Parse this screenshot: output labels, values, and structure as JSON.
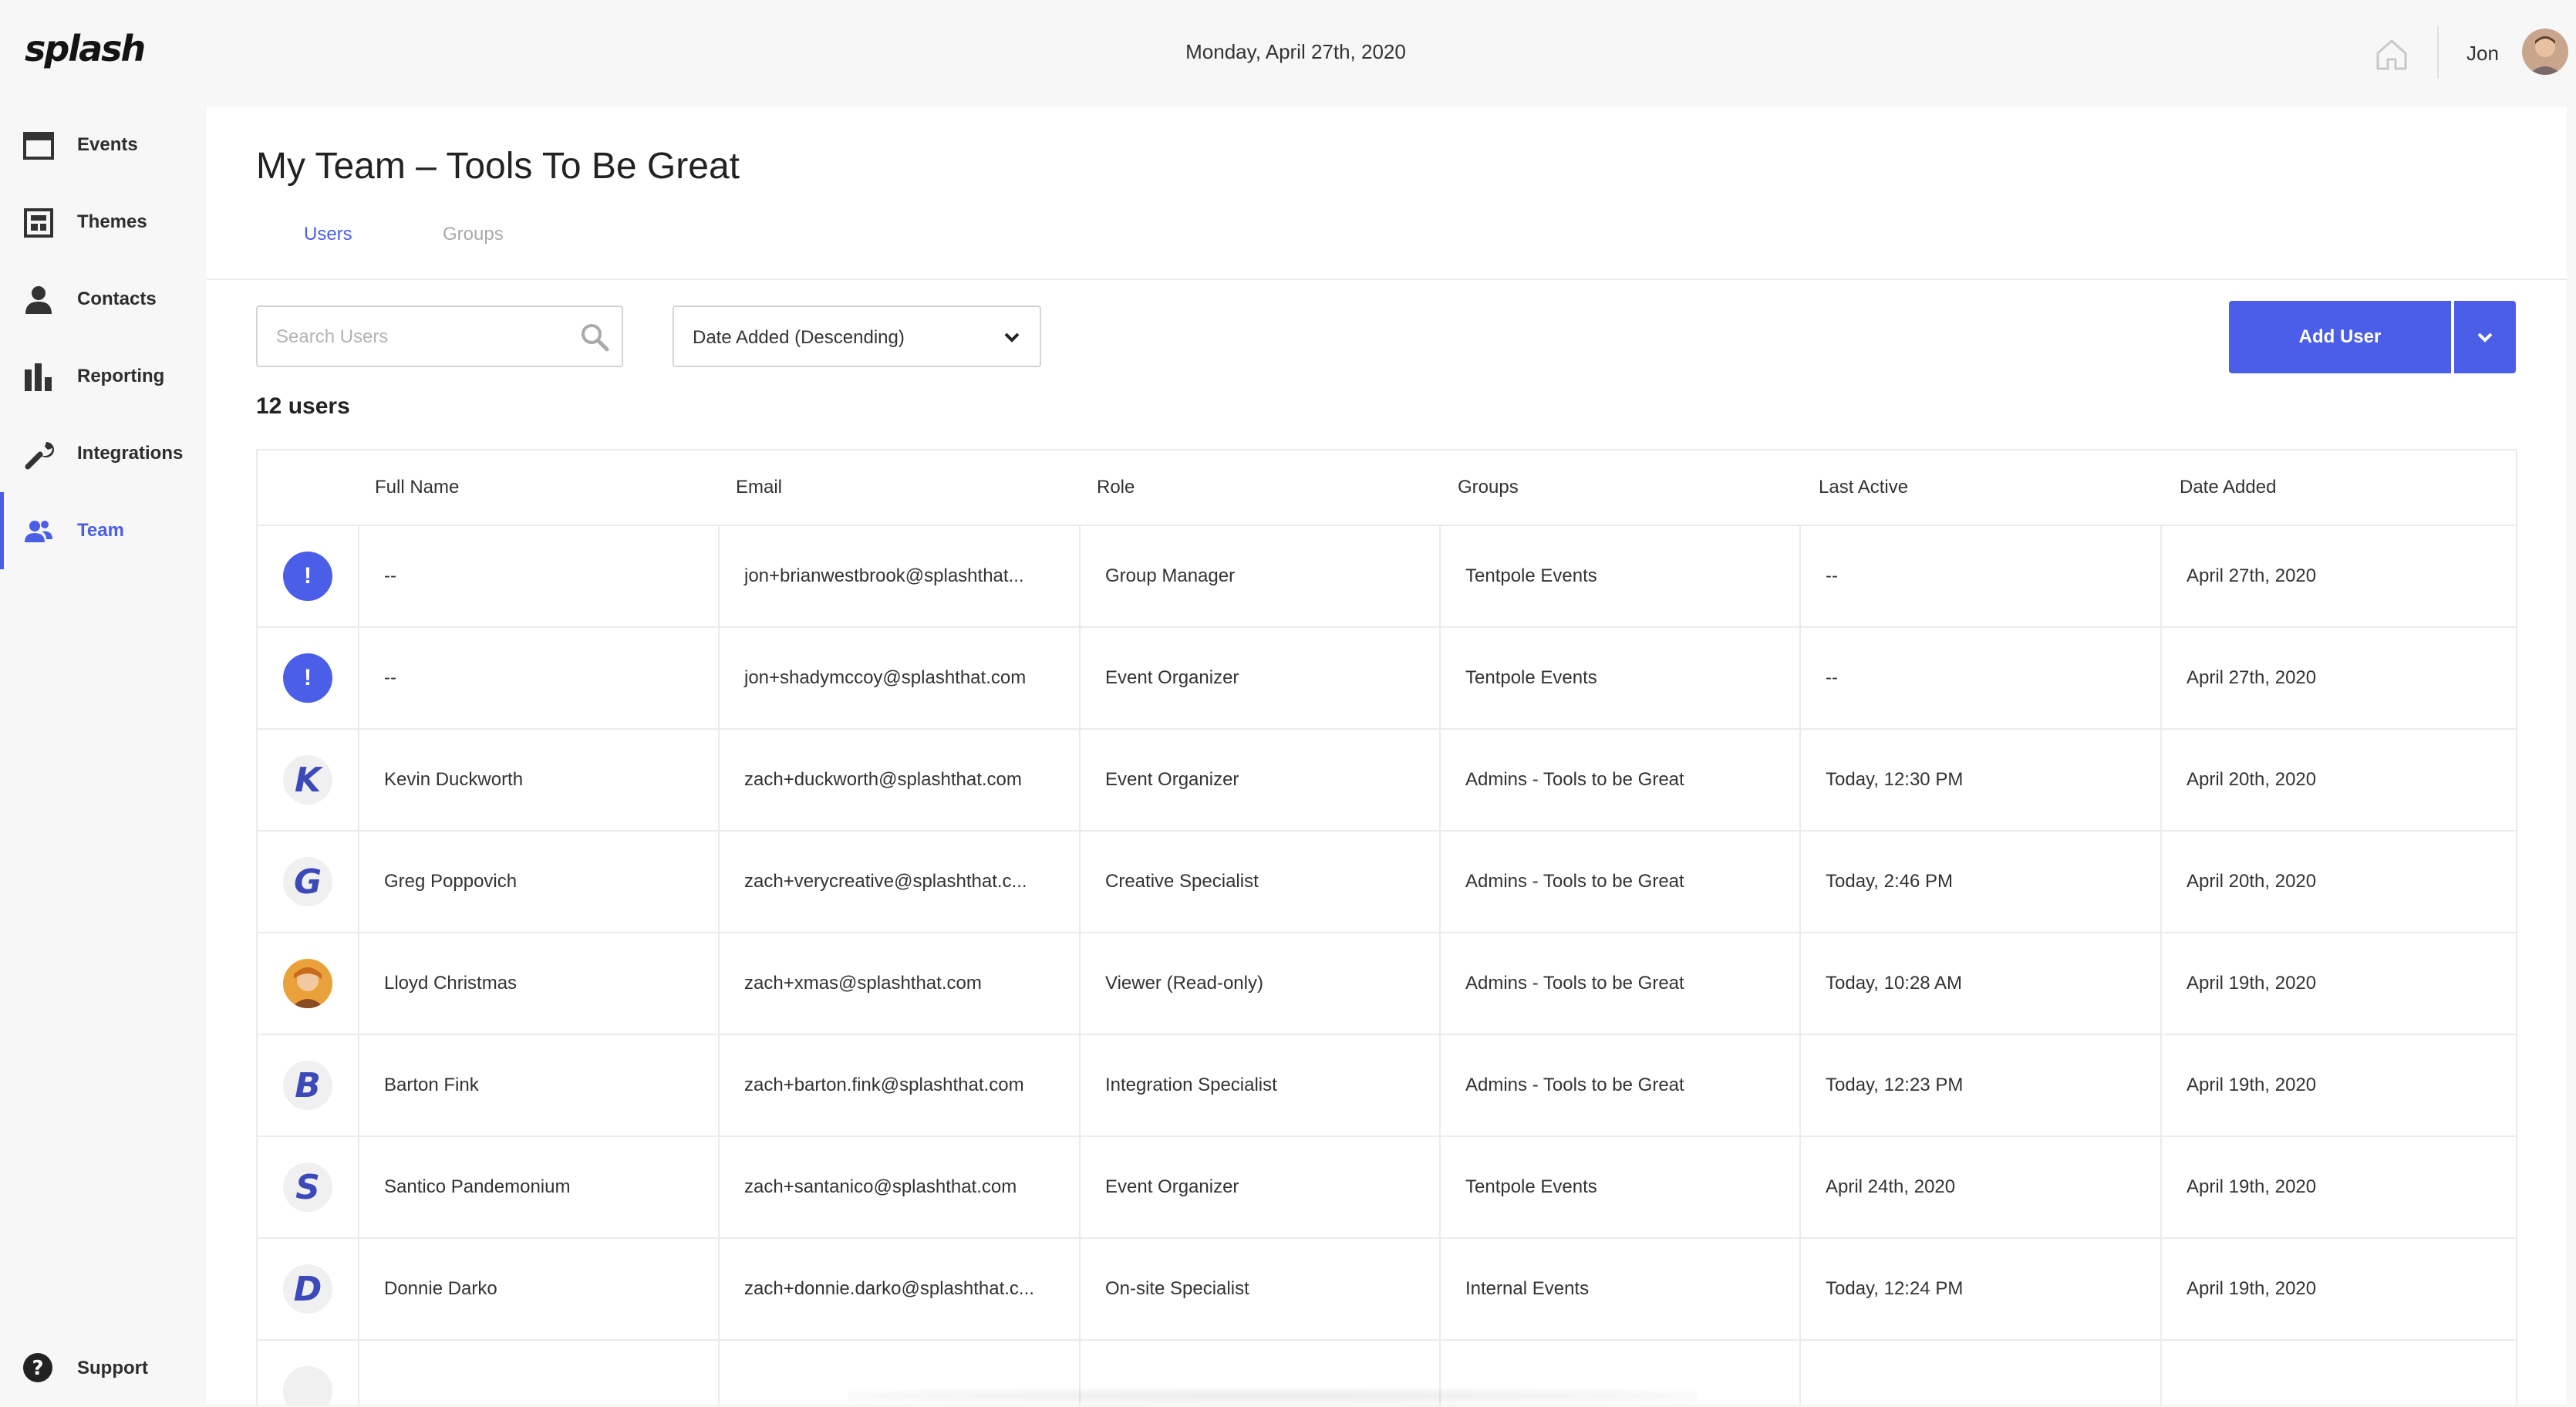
{
  "app": {
    "logo": "splash"
  },
  "header": {
    "date": "Monday, April 27th, 2020",
    "username": "Jon"
  },
  "sidebar": {
    "items": [
      {
        "label": "Events",
        "icon": "calendar-icon"
      },
      {
        "label": "Themes",
        "icon": "layout-icon"
      },
      {
        "label": "Contacts",
        "icon": "person-icon"
      },
      {
        "label": "Reporting",
        "icon": "bar-chart-icon"
      },
      {
        "label": "Integrations",
        "icon": "wrench-icon"
      },
      {
        "label": "Team",
        "icon": "team-icon",
        "active": true
      }
    ],
    "support": {
      "label": "Support",
      "icon": "question-icon"
    }
  },
  "page": {
    "title": "My Team – Tools To Be Great",
    "tabs": [
      {
        "label": "Users",
        "active": true
      },
      {
        "label": "Groups",
        "active": false
      }
    ],
    "search": {
      "placeholder": "Search Users",
      "value": ""
    },
    "sort": {
      "selected": "Date Added (Descending)"
    },
    "add_button": {
      "label": "Add User"
    },
    "user_count": "12 users"
  },
  "table": {
    "columns": [
      "Full Name",
      "Email",
      "Role",
      "Groups",
      "Last Active",
      "Date Added"
    ],
    "rows": [
      {
        "avatar": "alert",
        "avatar_text": "!",
        "name": "--",
        "email": "jon+brianwestbrook@splashthat...",
        "role": "Group Manager",
        "groups": "Tentpole Events",
        "last_active": "--",
        "date_added": "April 27th, 2020"
      },
      {
        "avatar": "alert",
        "avatar_text": "!",
        "name": "--",
        "email": "jon+shadymccoy@splashthat.com",
        "role": "Event Organizer",
        "groups": "Tentpole Events",
        "last_active": "--",
        "date_added": "April 27th, 2020"
      },
      {
        "avatar": "letter",
        "avatar_text": "K",
        "name": "Kevin Duckworth",
        "email": "zach+duckworth@splashthat.com",
        "role": "Event Organizer",
        "groups": "Admins - Tools to be Great",
        "last_active": "Today, 12:30 PM",
        "date_added": "April 20th, 2020"
      },
      {
        "avatar": "letter",
        "avatar_text": "G",
        "name": "Greg Poppovich",
        "email": "zach+verycreative@splashthat.c...",
        "role": "Creative Specialist",
        "groups": "Admins - Tools to be Great",
        "last_active": "Today, 2:46 PM",
        "date_added": "April 20th, 2020"
      },
      {
        "avatar": "photo",
        "avatar_text": "",
        "name": "Lloyd Christmas",
        "email": "zach+xmas@splashthat.com",
        "role": "Viewer (Read-only)",
        "groups": "Admins - Tools to be Great",
        "last_active": "Today, 10:28 AM",
        "date_added": "April 19th, 2020"
      },
      {
        "avatar": "letter",
        "avatar_text": "B",
        "name": "Barton Fink",
        "email": "zach+barton.fink@splashthat.com",
        "role": "Integration Specialist",
        "groups": "Admins - Tools to be Great",
        "last_active": "Today, 12:23 PM",
        "date_added": "April 19th, 2020"
      },
      {
        "avatar": "letter",
        "avatar_text": "S",
        "name": "Santico Pandemonium",
        "email": "zach+santanico@splashthat.com",
        "role": "Event Organizer",
        "groups": "Tentpole Events",
        "last_active": "April 24th, 2020",
        "date_added": "April 19th, 2020"
      },
      {
        "avatar": "letter",
        "avatar_text": "D",
        "name": "Donnie Darko",
        "email": "zach+donnie.darko@splashthat.c...",
        "role": "On-site Specialist",
        "groups": "Internal Events",
        "last_active": "Today, 12:24 PM",
        "date_added": "April 19th, 2020"
      },
      {
        "avatar": "letter",
        "avatar_text": "",
        "name": "",
        "email": "",
        "role": "",
        "groups": "",
        "last_active": "",
        "date_added": ""
      }
    ]
  },
  "colors": {
    "accent": "#4a5ee8",
    "background": "#f7f7f8",
    "panel": "#ffffff"
  }
}
